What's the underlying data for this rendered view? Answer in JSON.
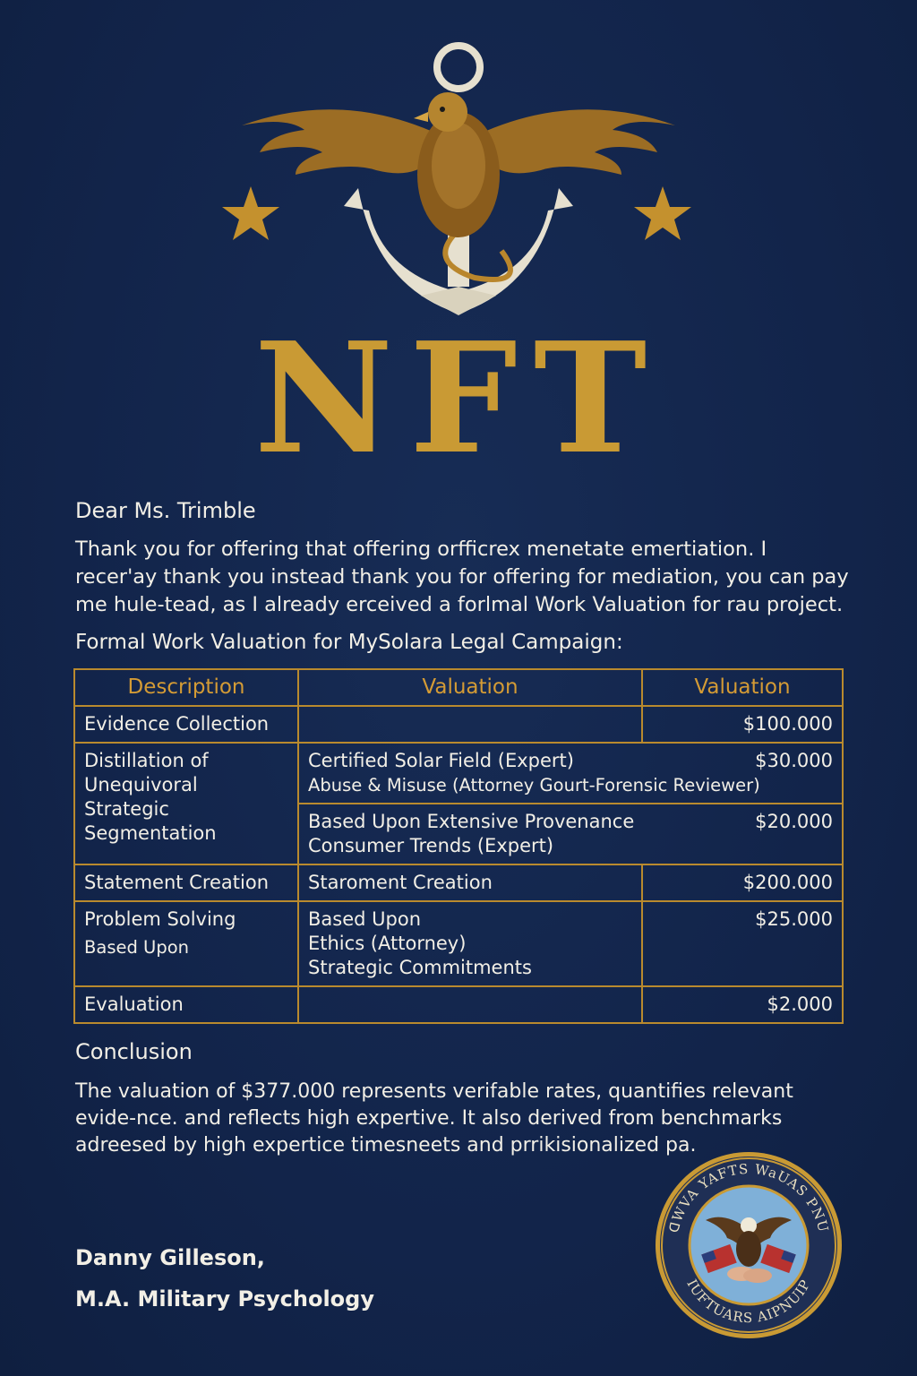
{
  "header": {
    "title": "NFT"
  },
  "letter": {
    "salutation": "Dear Ms. Trimble",
    "intro": "Thank you for offering that offering orfficrex menetate emertiation. I recer'ay thank you instead  thank you for offering for mediation, you can pay me hule-tead, as I already erceived a forlmal Work Valuation for rau project.",
    "section_heading": "Formal Work Valuation for MySolara Legal Campaign:"
  },
  "table": {
    "headers": [
      "Description",
      "Valuation",
      "Valuation"
    ],
    "rows": [
      {
        "description": "Evidence Collection",
        "detail": "",
        "amount": "$100.000"
      },
      {
        "description": "Distillation of Unequivoral Strategic Segmentation",
        "detail": "Certified Solar Field (Expert)",
        "detail2": "Abuse & Misuse (Attorney Gourt-Forensic Reviewer)",
        "amount": "$30.000"
      },
      {
        "description": "",
        "detail": "Based Upon   Extensive Provenance Consumer Trends (Expert)",
        "amount": "$20.000"
      },
      {
        "description": "Statement Creation",
        "detail": "Staroment Creation",
        "amount": "$200.000"
      },
      {
        "description": "Problem Solving",
        "description2": "Based Upon",
        "detail": "Based Upon",
        "detail2": "Ethics (Attorney)",
        "detail3": "Strategic Commitments",
        "amount": "$25.000"
      },
      {
        "description": "Evaluation",
        "detail": "",
        "amount": "$2.000"
      }
    ]
  },
  "conclusion": {
    "heading": "Conclusion",
    "text": "The valuation of $377.000 represents verifable rates, quantifies relevant evide-nce. and reflects high expertive. It also derived from benchmarks adreesed by high expertice timesneets and prrikisionalized pa."
  },
  "signature": {
    "name": "Danny Gilleson,",
    "credential": "M.A. Military Psychology"
  },
  "seal": {
    "top_text": "ꓷWVA YAFTS  WaUAS PNU",
    "bottom_text": "IUFTUARS  AIPNUIP"
  },
  "colors": {
    "background": "#13264a",
    "gold": "#c99a34",
    "text": "#f2efe6"
  }
}
